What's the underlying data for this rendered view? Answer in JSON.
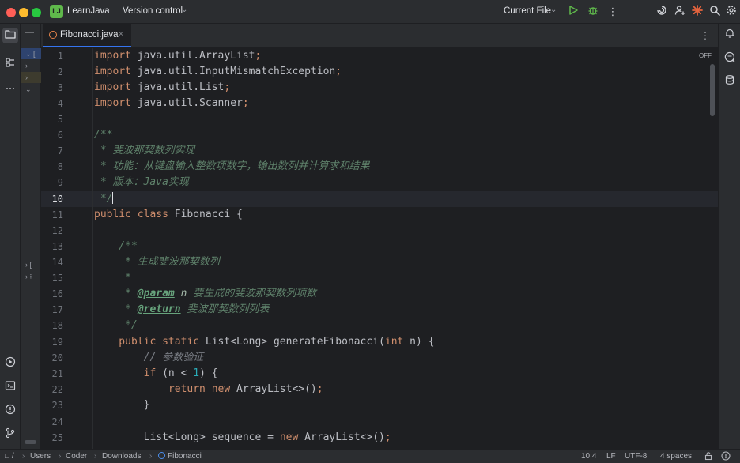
{
  "titlebar": {
    "project_badge": "LJ",
    "project_name": "LearnJava",
    "vcs_label": "Version control",
    "run_config": "Current File",
    "icons": [
      "run-icon",
      "debug-icon",
      "more-icon",
      "ai-swirl-icon",
      "add-user-icon",
      "notification-burst-icon",
      "search-icon",
      "settings-icon"
    ]
  },
  "tab": {
    "label": "Fibonacci.java",
    "close_glyph": "×"
  },
  "editor": {
    "inspection_label": "OFF",
    "current_line": 10,
    "line_numbers": [
      "1",
      "2",
      "3",
      "4",
      "5",
      "6",
      "7",
      "8",
      "9",
      "10",
      "11",
      "12",
      "13",
      "14",
      "15",
      "16",
      "17",
      "18",
      "19",
      "20",
      "21",
      "22",
      "23",
      "24",
      "25"
    ]
  },
  "code": {
    "l1": [
      "import",
      " java.util.ArrayList",
      ";"
    ],
    "l2": [
      "import",
      " java.util.InputMismatchException",
      ";"
    ],
    "l3": [
      "import",
      " java.util.List",
      ";"
    ],
    "l4": [
      "import",
      " java.util.Scanner",
      ";"
    ],
    "l6": "/**",
    "l7": " * 斐波那契数列实现",
    "l8": " * 功能：从键盘输入整数项数字，输出数列并计算求和结果",
    "l9": [
      " * 版本：",
      "Java",
      "实现"
    ],
    "l10": " */",
    "l11": [
      "public class",
      " Fibonacci {"
    ],
    "l13": "    /**",
    "l14": "     * 生成斐波那契数列",
    "l15": "     *",
    "l16": [
      "     * ",
      "@param",
      " n",
      " 要生成的斐波那契数列项数"
    ],
    "l17": [
      "     * ",
      "@return",
      " 斐波那契数列列表"
    ],
    "l18": "     */",
    "l19": [
      "    public static",
      " List<Long> generateFibonacci(",
      "int",
      " n) {"
    ],
    "l20": "        // 参数验证",
    "l21": [
      "        if",
      " (n < ",
      "1",
      ") {"
    ],
    "l22": [
      "            return new",
      " ArrayList<>()",
      ";"
    ],
    "l23": "        }",
    "l25": [
      "        List<Long> sequence = ",
      "new",
      " ArrayList<>()",
      ";"
    ]
  },
  "project_panel": {
    "rows": [
      "⌄ [",
      "›",
      "›",
      "⌄",
      "› [",
      "› ⁝"
    ]
  },
  "breadcrumb": [
    "Users",
    "Coder",
    "Downloads",
    "Fibonacci"
  ],
  "breadcrumb_root": "□ /",
  "status": {
    "position": "10:4",
    "line_sep": "LF",
    "encoding": "UTF-8",
    "indent": "4 spaces"
  }
}
